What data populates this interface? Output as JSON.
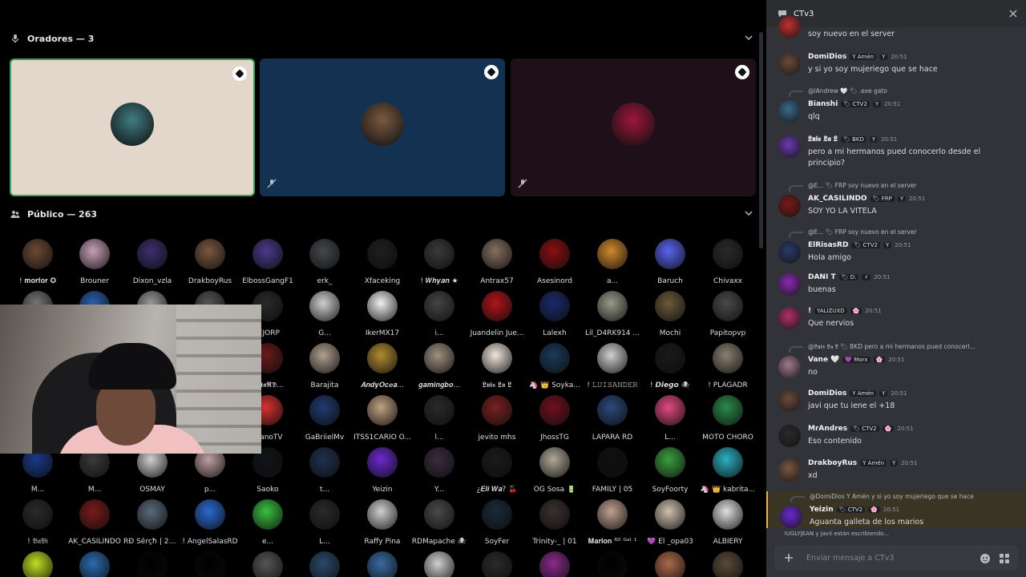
{
  "speakers": {
    "header": "Oradores — 3",
    "tiles": [
      {
        "bg": "#e3d6ca",
        "avatar": "#3e7d83",
        "border": "#3ba55d",
        "badge": "stage-moderator-icon",
        "muted": false
      },
      {
        "bg": "#133150",
        "avatar": "#7a5a40",
        "border": "",
        "badge": "stage-moderator-icon",
        "muted": true
      },
      {
        "bg": "#1f0f19",
        "avatar": "#a0163a",
        "border": "",
        "badge": "stage-moderator-icon",
        "muted": true
      }
    ]
  },
  "audience": {
    "header": "Público — 263",
    "rows": [
      [
        "! 𝐦𝐨𝐫𝐟𝐨𝐫 ✪",
        "Brouner",
        "Dixon_vzla",
        "DrakboyRus",
        "ElbossGangF1",
        "erk_",
        "Xfaceking",
        "! 𝑾𝒉𝒚𝒂𝒏 ★",
        "Antrax57",
        "Asesinord",
        "a...",
        "Baruch",
        "Chivaxx"
      ],
      [
        "",
        "",
        "",
        "",
        "IEJORP",
        "G...",
        "IkerMX17",
        "i...",
        "Juandelin Jue...",
        "Lalexh",
        "Lil_D4RK914 ...",
        "Mochi",
        "Papitopvp"
      ],
      [
        "",
        "",
        "",
        "",
        "𝕽𝖆𝖙𝖔𝕽𝕯...",
        "Barajita",
        "𝑨𝒏𝒅𝒚𝑶𝒄𝒆𝒂...",
        "𝒈𝒂𝒎𝒊𝒏𝒈𝒃𝒐...",
        "𝕷𝖚𝖎𝖘 𝕷𝖆 𝕷",
        "🦄 👑 Soyka...",
        "! 𝙻𝚄𝙸𝚂𝙰𝙽𝙳𝙴𝚁",
        "! 𝘿𝙞𝙚𝙜𝙤 🕷",
        "! PLAGADR"
      ],
      [
        "",
        "",
        "",
        "",
        "manoTV",
        "GaBriielMv",
        "ITSS1CARIO O...",
        "l...",
        "jevito mhs",
        "JhossTG",
        "LAPARA RD",
        "L...",
        "MOTO CHORO"
      ],
      [
        "M...",
        "M...",
        "OSMAY",
        "p...",
        "Saoko",
        "t...",
        "Yeizin",
        "Y...",
        "¿𝑬𝒍𝒊 𝑾𝒂? 🍒",
        "OG Sosa 🔋",
        "FAMILY | 05",
        "SoyFoorty",
        "🦄 👑 kabrita..."
      ],
      [
        "! 𝔅𝔞𝔅𝔦",
        "AK_CASILINDO",
        "RĐ Šērçħ | 2D ...",
        "! AngelSalasRD",
        "e...",
        "L...",
        "Raffy Pina",
        "RDMapache 🕷",
        "SoyFer",
        "Trinity-_ | 01",
        "𝐌𝐚𝐫𝐥𝐨𝐧 ᴿᴰ ᴳᵃᵗ ¹",
        "💜 El _opa03",
        "ALBIERY"
      ],
      [
        "",
        "",
        "",
        "",
        "",
        "",
        "",
        "",
        "",
        "",
        "",
        "",
        ""
      ]
    ],
    "colors": [
      [
        "#6b4a34",
        "#c9a0b8",
        "#3c2f6e",
        "#7a5840",
        "#4b3a8a",
        "#44484c",
        "#1e1e1e",
        "#3a3a3a",
        "#86705e",
        "#8a1010",
        "#d08a2a",
        "#5865f2",
        "#2a2a2a"
      ],
      [
        "#777",
        "#2b5fb0",
        "#999",
        "#555",
        "#2a2a2a",
        "#d0d0d0",
        "#f0f0f0",
        "#444",
        "#b0141a",
        "#1a2a6a",
        "#9a9a8a",
        "#6a5a3a",
        "#4a4a4a"
      ],
      [
        "#777",
        "#2b5fb0",
        "#999",
        "#555",
        "#6a1a1a",
        "#b0a090",
        "#b08a30",
        "#a09080",
        "#f0e6dc",
        "#1a3a5a",
        "#d0d0d0",
        "#1a1a1a",
        "#8a8070"
      ],
      [
        "#777",
        "#2b5fb0",
        "#999",
        "#555",
        "#d83030",
        "#203a70",
        "#c0a080",
        "#2a2a2a",
        "#7a2020",
        "#701020",
        "#2a4a7a",
        "#e04a80",
        "#2a8a4a"
      ],
      [
        "#1a3a8a",
        "#3a3a3a",
        "#d0d0d0",
        "#c0a0a0",
        "#101418",
        "#203050",
        "#6a2ad0",
        "#3a2a40",
        "#1a1a1a",
        "#b0a898",
        "#101010",
        "#3aa040",
        "#2ab0c0"
      ],
      [
        "#2a2a2a",
        "#7a1a1a",
        "#5a6a7a",
        "#2a6ad0",
        "#3ac040",
        "#2a2a2a",
        "#d0d0d0",
        "#4a4a4a",
        "#1a2a3a",
        "#3a3030",
        "#c0a090",
        "#d0c0b0",
        "#e0e0e0"
      ],
      [
        "#c0e020",
        "#2a6ab0",
        "#000000",
        "#000000",
        "#555555",
        "#2a4a6a",
        "#3a6aa0",
        "#d0d0d0",
        "#2a2a2a",
        "#8a2a8a",
        "#000000",
        "#aa6a4a",
        "#5a4a3a"
      ]
    ]
  },
  "chat": {
    "title": "CTv3",
    "messages": [
      {
        "type": "cont",
        "text": "soy nuevo en el server",
        "avatar": "#c03030"
      },
      {
        "name": "DomiDios",
        "nameColor": "#f2f3f5",
        "tags": [
          "Y Amén",
          "Y"
        ],
        "time": "20:51",
        "text": "y si yo soy mujeriego que se hace",
        "avatar": "#6a4a3a"
      },
      {
        "reply": "@lAndrew 🤍 🏷 .exe gato",
        "name": "Bianshi",
        "tags": [
          "🏷 CTV2",
          "Y"
        ],
        "time": "20:51",
        "text": "qlq",
        "avatar": "#3a6a8a"
      },
      {
        "name": "𝕷𝖚𝖎𝖘 𝕷𝖆 𝕷",
        "tags": [
          "🏷 BKD",
          "Y"
        ],
        "time": "20:51",
        "text": "pero a mi hermanos pued conocerlo desde el principio?",
        "avatar": "#6a3ab0"
      },
      {
        "reply": "@E... 🏷 FRP soy nuevo en el server",
        "name": "AK_CASILINDO",
        "tags": [
          "🏷 FRP",
          "Y"
        ],
        "time": "20:51",
        "text": "SOY YO LA VITELA",
        "avatar": "#7a1a1a"
      },
      {
        "reply": "@E... 🏷 FRP soy nuevo en el server",
        "name": "ElRisasRD",
        "tags": [
          "🏷 CTV2",
          "Y"
        ],
        "time": "20:51",
        "text": "Hola amigo",
        "avatar": "#2a3a6a"
      },
      {
        "name": "DANI T",
        "tags": [
          "🏷 D.",
          "⚡"
        ],
        "time": "20:51",
        "text": "buenas",
        "avatar": "#8a2ab0"
      },
      {
        "name": "!",
        "tags": [
          "YALIZUXD",
          "🌸"
        ],
        "time": "20:51",
        "text": "Que nervios",
        "avatar": "#b0306a"
      },
      {
        "reply": "@𝕷𝖚𝖎𝖘 𝕷𝖆 𝕷 🏷 BKD pero a mi hermanos pued conocerl...",
        "name": "Vane 🤍",
        "tags": [
          "💜 Morx",
          "🌸"
        ],
        "time": "20:51",
        "text": "no",
        "avatar": "#a07a8a"
      },
      {
        "name": "DomiDios",
        "tags": [
          "Y Amén",
          "Y"
        ],
        "time": "20:51",
        "text": "javi que tu iene el +18",
        "avatar": "#6a4a3a"
      },
      {
        "name": "MrAndres",
        "tags": [
          "🏷 CTV2",
          "🌸"
        ],
        "time": "20:51",
        "text": "Eso contenido",
        "avatar": "#2a2a2a"
      },
      {
        "name": "DrakboyRus",
        "tags": [
          "Y Amén",
          "Y"
        ],
        "time": "20:51",
        "text": "xd",
        "avatar": "#7a5840"
      },
      {
        "reply": "@DomiDios Y Amén y si yo soy mujeriego que se hace",
        "name": "Yeizin",
        "tags": [
          "🏷 CTV2",
          "🌸"
        ],
        "time": "20:51",
        "text": "Aguanta galleta de los marios",
        "avatar": "#6a2ad0",
        "highlight": true
      }
    ],
    "typing": "!UGLYJEAN y Javii están escribiendo...",
    "input_placeholder": "Enviar mensaje a CTv3"
  },
  "icons": {
    "mic": "microphone-icon",
    "audience": "audience-icon",
    "chevron": "chevron-down-icon",
    "chat": "chat-bubble-icon",
    "close": "close-icon",
    "plus": "plus-circle-icon",
    "emoji": "emoji-icon",
    "apps": "apps-icon"
  }
}
